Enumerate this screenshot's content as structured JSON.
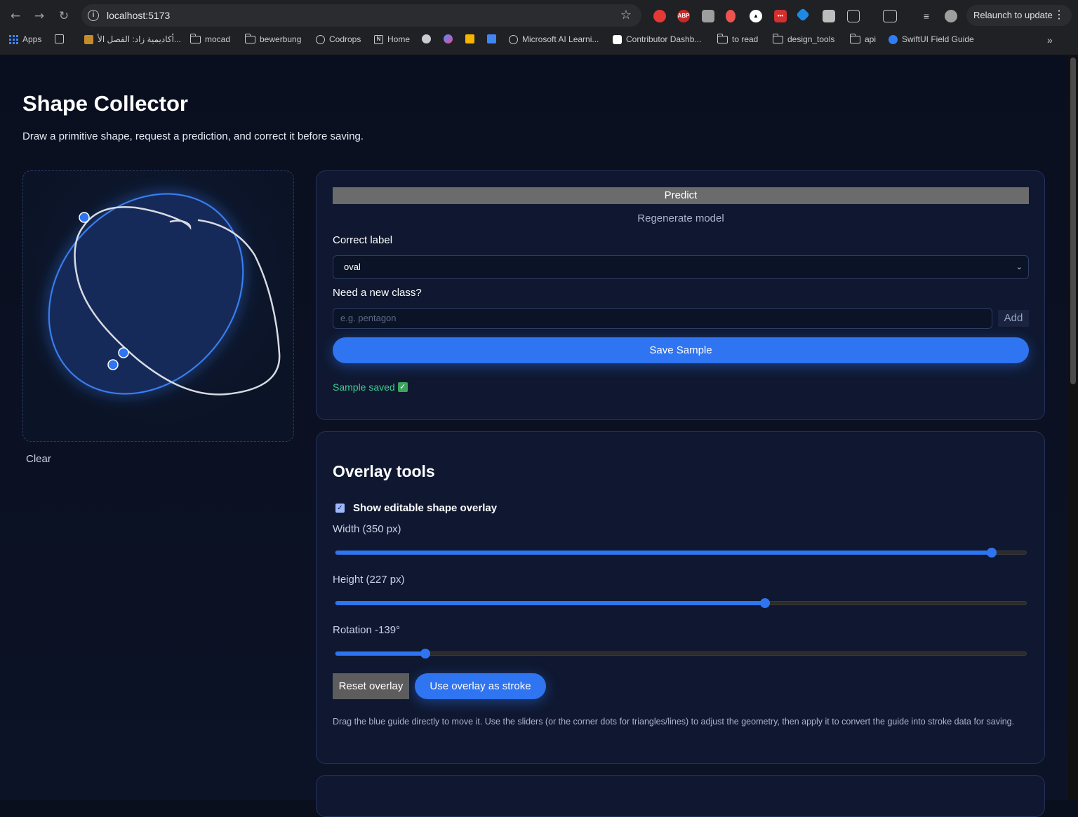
{
  "browser": {
    "url": "localhost:5173",
    "relaunch_label": "Relaunch to update",
    "bookmarks": [
      {
        "label": "Apps",
        "icon": "apps-grid-icon"
      },
      {
        "label": "أكاديمية زاد: الفصل الأ...",
        "icon": "zad-icon"
      },
      {
        "label": "mocad",
        "icon": "folder-icon"
      },
      {
        "label": "bewerbung",
        "icon": "folder-icon"
      },
      {
        "label": "Codrops",
        "icon": "globe-icon"
      },
      {
        "label": "Home",
        "icon": "notion-icon"
      },
      {
        "label": "Microsoft AI Learni...",
        "icon": "globe-icon"
      },
      {
        "label": "Contributor Dashb...",
        "icon": "contributor-icon"
      },
      {
        "label": "to read",
        "icon": "folder-icon"
      },
      {
        "label": "design_tools",
        "icon": "folder-icon"
      },
      {
        "label": "api",
        "icon": "folder-icon"
      },
      {
        "label": "SwiftUI Field Guide",
        "icon": "swiftui-icon"
      }
    ]
  },
  "header": {
    "title": "Shape Collector",
    "subtitle": "Draw a primitive shape, request a prediction, and correct it before saving."
  },
  "canvas": {
    "clear_label": "Clear"
  },
  "prediction_panel": {
    "predict_label": "Predict",
    "regenerate_label": "Regenerate model",
    "correct_label_heading": "Correct label",
    "selected_label": "oval",
    "new_class_heading": "Need a new class?",
    "new_class_placeholder": "e.g. pentagon",
    "add_label": "Add",
    "save_label": "Save Sample",
    "status_text": "Sample saved"
  },
  "overlay_panel": {
    "title": "Overlay tools",
    "show_overlay_label": "Show editable shape overlay",
    "show_overlay_checked": true,
    "width_label": "Width (350 px)",
    "width_fraction": 0.95,
    "height_label": "Height (227 px)",
    "height_fraction": 0.622,
    "rotation_label": "Rotation -139°",
    "rotation_fraction": 0.13,
    "reset_label": "Reset overlay",
    "use_overlay_label": "Use overlay as stroke",
    "help_text": "Drag the blue guide directly to move it. Use the sliders (or the corner dots for triangles/lines) to adjust the geometry, then apply it to convert the guide into stroke data for saving."
  },
  "colors": {
    "accent": "#2f74f0",
    "success": "#3ecf8e",
    "background": "#0a0f1e",
    "panel": "#0f1830"
  }
}
